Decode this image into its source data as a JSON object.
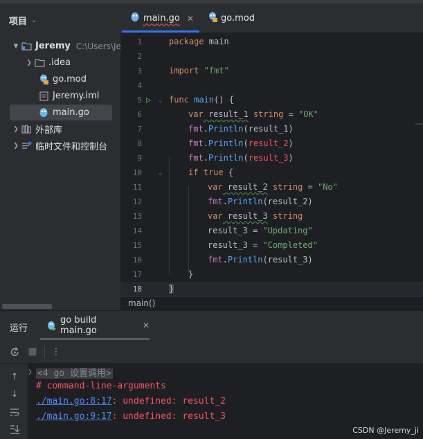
{
  "project": {
    "title": "项目",
    "tree": [
      {
        "label": "Jeremy",
        "path": "C:\\Users\\Jer",
        "type": "folder-open"
      },
      {
        "label": ".idea",
        "type": "folder"
      },
      {
        "label": "go.mod",
        "type": "gomod"
      },
      {
        "label": "Jeremy.iml",
        "type": "iml"
      },
      {
        "label": "main.go",
        "type": "gofile"
      },
      {
        "label": "外部库",
        "type": "library"
      },
      {
        "label": "临时文件和控制台",
        "type": "scratch"
      }
    ]
  },
  "tabs": [
    {
      "label": "main.go",
      "active": true
    },
    {
      "label": "go.mod",
      "active": false
    }
  ],
  "editor": {
    "line_numbers": [
      "1",
      "2",
      "3",
      "4",
      "5",
      "6",
      "7",
      "8",
      "9",
      "10",
      "11",
      "12",
      "13",
      "14",
      "15",
      "16",
      "17",
      "18"
    ],
    "tokens": {
      "l1a": "package",
      "l1b": " main",
      "l3a": "import",
      "l3b": " \"fmt\"",
      "l5a": "func",
      "l5b": " main",
      "l5c": "() {",
      "l6a": "var",
      "l6b": " result_1",
      "l6c": " string",
      "l6d": " = ",
      "l6e": "\"OK\"",
      "l7a": "fmt",
      "l7b": ".",
      "l7c": "Println",
      "l7d": "(result_1)",
      "l8a": "fmt",
      "l8b": ".",
      "l8c": "Println",
      "l8d": "(",
      "l8e": "result_2",
      "l8f": ")",
      "l9a": "fmt",
      "l9b": ".",
      "l9c": "Println",
      "l9d": "(",
      "l9e": "result_3",
      "l9f": ")",
      "l10a": "if",
      "l10b": " ",
      "l10c": "true",
      "l10d": " {",
      "l11a": "var",
      "l11b": " result_2",
      "l11c": " string",
      "l11d": " = ",
      "l11e": "\"No\"",
      "l12a": "fmt",
      "l12b": ".",
      "l12c": "Println",
      "l12d": "(result_2)",
      "l13a": "var",
      "l13b": " result_3",
      "l13c": " string",
      "l14a": "result_3 = ",
      "l14b": "\"Updating\"",
      "l15a": "result_3 = ",
      "l15b": "\"Completed\"",
      "l16a": "fmt",
      "l16b": ".",
      "l16c": "Println",
      "l16d": "(result_3)",
      "l17": "}",
      "l18": "}"
    }
  },
  "breadcrumb": "main()",
  "run": {
    "panel_title": "运行",
    "tab_label": "go build main.go",
    "console": {
      "l1": "<4 go 设置调用>",
      "l2": "# command-line-arguments",
      "l3link": "./main.go:8:17",
      "l3text": ": undefined: result_2",
      "l4link": "./main.go:9:17",
      "l4text": ": undefined: result_3"
    }
  },
  "watermark": "CSDN @Jeremy_ji",
  "colors": {
    "accent": "#3574f0",
    "keyword": "#cf8e6d",
    "string": "#6aab73",
    "function": "#56a8f5",
    "package": "#c77dbb",
    "error": "#f75464",
    "link": "#548af7"
  }
}
